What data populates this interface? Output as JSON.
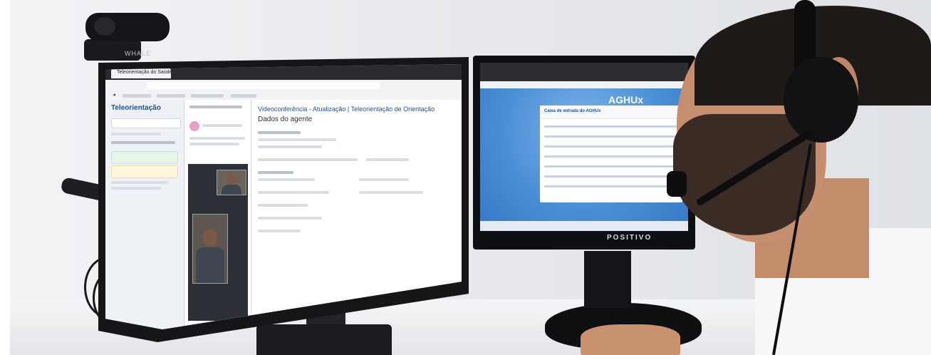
{
  "scene": {
    "left_monitor": {
      "app_title": "Teleorientação",
      "browser_tab": "Teleorientação do Saúde 24",
      "main_heading": "Videoconferência - Atualização | Teleorientação de Orientação",
      "section_title": "Dados do agente",
      "webcam_brand": "WHALE"
    },
    "right_monitor": {
      "app_logo": "AGHUx",
      "panel_title": "Caixa de entrada do AGHUx",
      "brand": "POSITIVO"
    },
    "colors": {
      "app_blue": "#1d4f9f",
      "right_app_blue": "#4a8fd6",
      "monitor_black": "#151618"
    }
  }
}
